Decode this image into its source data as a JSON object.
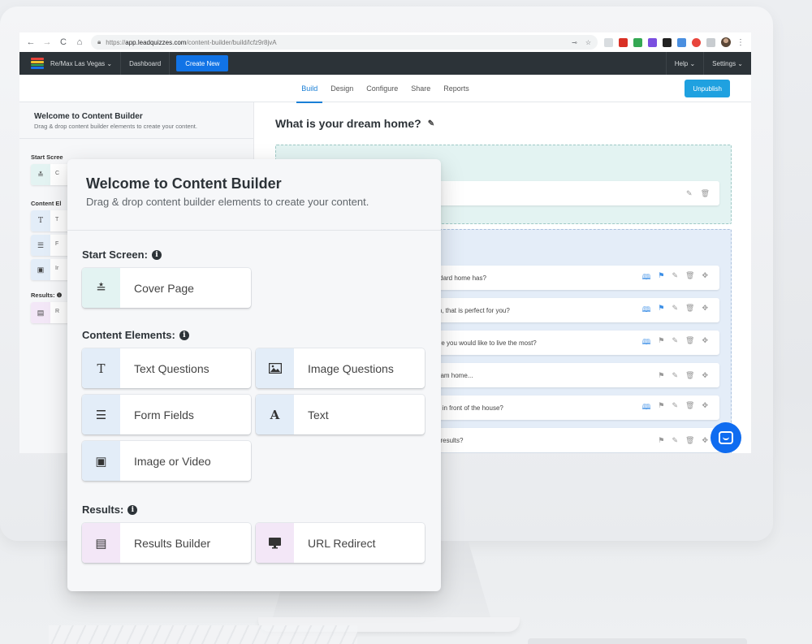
{
  "browser": {
    "url_prefix": "https://",
    "url_host": "app.leadquizzes.com",
    "url_path": "/content-builder/build/lcfz9r8jvA",
    "nav": {
      "back": "←",
      "forward": "→",
      "reload": "C",
      "home": "⌂"
    },
    "key_icon": "⊸",
    "star_icon": "☆",
    "menu_icon": "⋮",
    "extension_colors": [
      "#d9dde0",
      "#d93025",
      "#34a853",
      "#7b4fe0",
      "#222222",
      "#4a8fe0",
      "#e8453c",
      "#c8ccd0"
    ]
  },
  "app_nav": {
    "brand_label": "Re/Max Las Vegas ⌄",
    "dashboard_label": "Dashboard",
    "create_new_label": "Create New",
    "help_label": "Help ⌄",
    "settings_label": "Settings ⌄",
    "logo_colors": [
      "#e8453c",
      "#4a9fe0",
      "#f2c12e",
      "#34a853",
      "#1a73e8"
    ]
  },
  "tabs": [
    {
      "label": "Build",
      "active": true
    },
    {
      "label": "Design",
      "active": false
    },
    {
      "label": "Configure",
      "active": false
    },
    {
      "label": "Share",
      "active": false
    },
    {
      "label": "Reports",
      "active": false
    }
  ],
  "unpublish_label": "Unpublish",
  "left_panel": {
    "title": "Welcome to Content Builder",
    "subtitle": "Drag & drop content builder elements to create your content.",
    "start_screen_label": "Start Scree",
    "content_elements_label": "Content El",
    "results_label": "Results: ❶",
    "tiles": [
      {
        "icon": "≛",
        "letter": "C"
      },
      {
        "icon": "T",
        "letter": "T"
      },
      {
        "icon": "☰",
        "letter": "F"
      },
      {
        "icon": "▣",
        "letter": "Ir"
      },
      {
        "icon": "▤",
        "letter": "R"
      }
    ]
  },
  "canvas": {
    "title": "What is your dream home?",
    "edit_icon": "✎",
    "questions": [
      {
        "text": "standard home has?",
        "icons": [
          "map",
          "branch",
          "edit",
          "trash",
          "move"
        ],
        "map_active": true,
        "branch_active": true
      },
      {
        "text": "room, that is perfect for you?",
        "icons": [
          "map",
          "branch",
          "edit",
          "trash",
          "move"
        ],
        "map_active": true,
        "branch_active": true
      },
      {
        "text": "where you would like to live the most?",
        "icons": [
          "map",
          "branch",
          "edit",
          "trash",
          "move"
        ],
        "map_active": true,
        "branch_active": false
      },
      {
        "text": "r dream home...",
        "icons": [
          "branch",
          "edit",
          "trash",
          "move"
        ],
        "map_active": false,
        "branch_active": false
      },
      {
        "text": "avell in front of the house?",
        "icons": [
          "map",
          "branch",
          "edit",
          "trash",
          "move"
        ],
        "map_active": true,
        "branch_active": false
      },
      {
        "text": "way results?",
        "icons": [
          "branch",
          "edit",
          "trash",
          "move"
        ],
        "map_active": false,
        "branch_active": false
      }
    ]
  },
  "overlay": {
    "title": "Welcome to Content Builder",
    "subtitle": "Drag & drop content builder elements to create your content.",
    "sections": {
      "start_screen": {
        "label": "Start Screen:",
        "items": [
          {
            "label": "Cover Page",
            "icon": "≛"
          }
        ]
      },
      "content_elements": {
        "label": "Content Elements:",
        "items": [
          {
            "label": "Text Questions",
            "icon": "T"
          },
          {
            "label": "Image Questions",
            "icon": "🖼"
          },
          {
            "label": "Form Fields",
            "icon": "☰"
          },
          {
            "label": "Text",
            "icon": "A"
          },
          {
            "label": "Image or Video",
            "icon": "▣"
          }
        ]
      },
      "results": {
        "label": "Results:",
        "items": [
          {
            "label": "Results Builder",
            "icon": "▤"
          },
          {
            "label": "URL Redirect",
            "icon": "🖵"
          }
        ]
      }
    },
    "info_glyph": "i"
  },
  "colors": {
    "accent_blue": "#1173e6",
    "tab_active": "#1a7fd6",
    "unpublish": "#1fa1e0",
    "start_screen_tint": "#e3f3f2",
    "content_tint": "#e3edf8",
    "results_tint": "#f3e7f7",
    "chat": "#0f6cf0"
  }
}
